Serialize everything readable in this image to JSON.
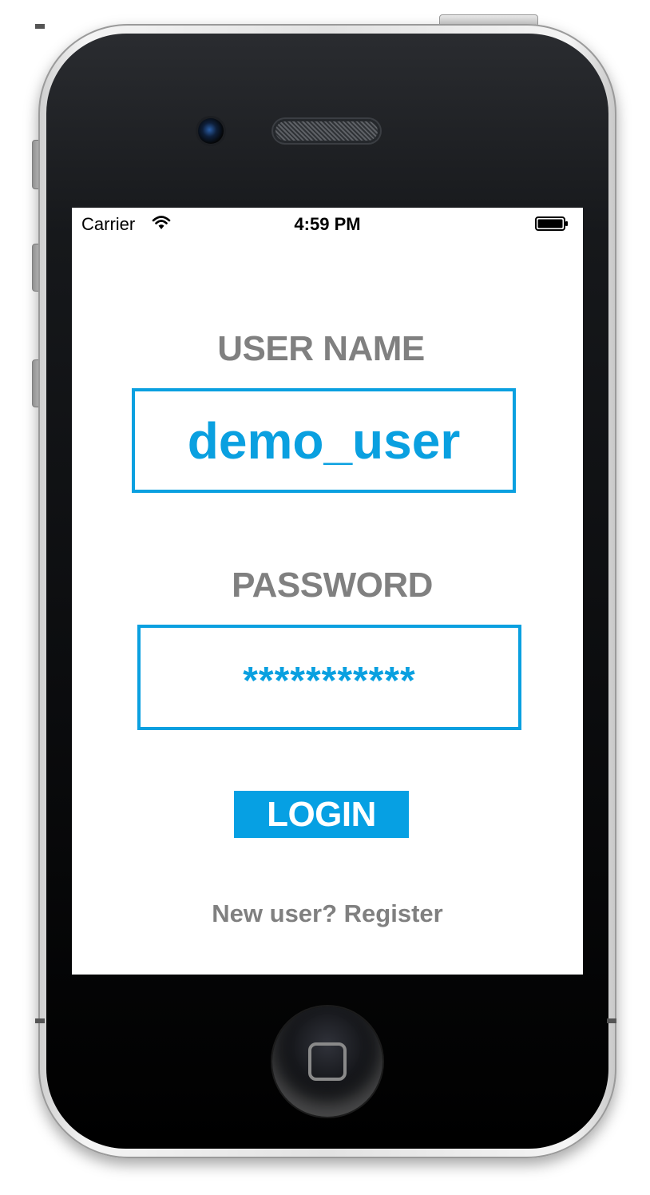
{
  "status_bar": {
    "carrier": "Carrier",
    "time": "4:59 PM"
  },
  "login_form": {
    "username_label": "USER NAME",
    "username_value": "demo_user",
    "password_label": "PASSWORD",
    "password_value": "***********",
    "login_button": "LOGIN",
    "register_link": "New user? Register"
  },
  "colors": {
    "accent": "#06a0e3",
    "label_gray": "#808080"
  },
  "icons": [
    "wifi-icon",
    "battery-icon",
    "camera-lens",
    "speaker-grille",
    "home-button"
  ]
}
